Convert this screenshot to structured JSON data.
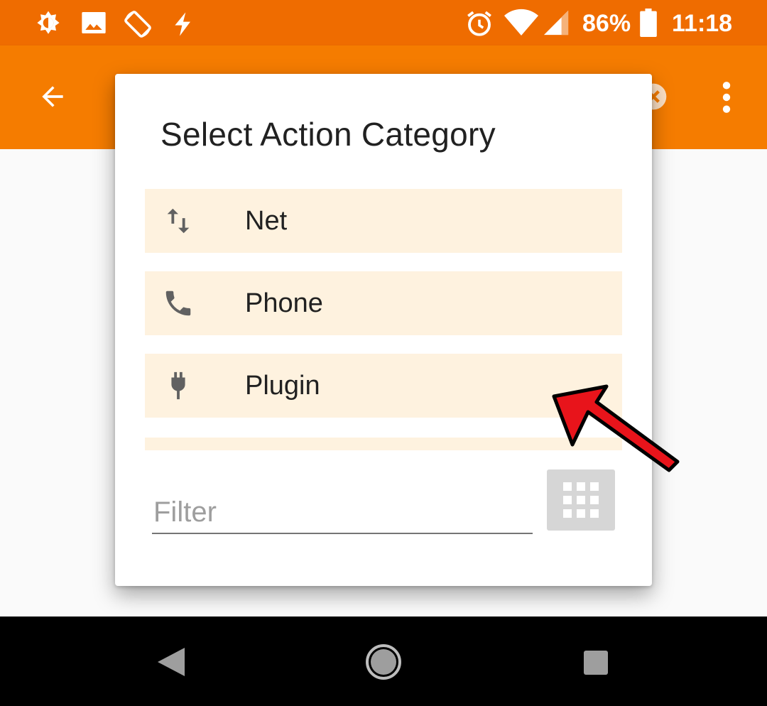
{
  "status_bar": {
    "battery_percent": "86%",
    "time": "11:18",
    "left_icons": [
      "brightness-icon",
      "image-icon",
      "screen-rotation-icon",
      "flash-icon"
    ],
    "right_icons": [
      "alarm-icon",
      "wifi-icon",
      "cell-signal-icon",
      "battery-icon"
    ]
  },
  "app_bar": {
    "background": "#f57c00",
    "icons": [
      "back-arrow-icon",
      "clear-icon",
      "more-vert-icon"
    ]
  },
  "dialog": {
    "title": "Select Action Category",
    "items": [
      {
        "label": "Net",
        "icon": "swap-vertical-icon"
      },
      {
        "label": "Phone",
        "icon": "phone-icon"
      },
      {
        "label": "Plugin",
        "icon": "plug-icon"
      }
    ],
    "filter": {
      "placeholder": "Filter",
      "value": ""
    },
    "grid_button_icon": "grid-icon"
  },
  "colors": {
    "status_bar": "#ef6c00",
    "accent": "#f57c00",
    "item_background": "#fef2df",
    "annotation_arrow": "#e8141b"
  }
}
